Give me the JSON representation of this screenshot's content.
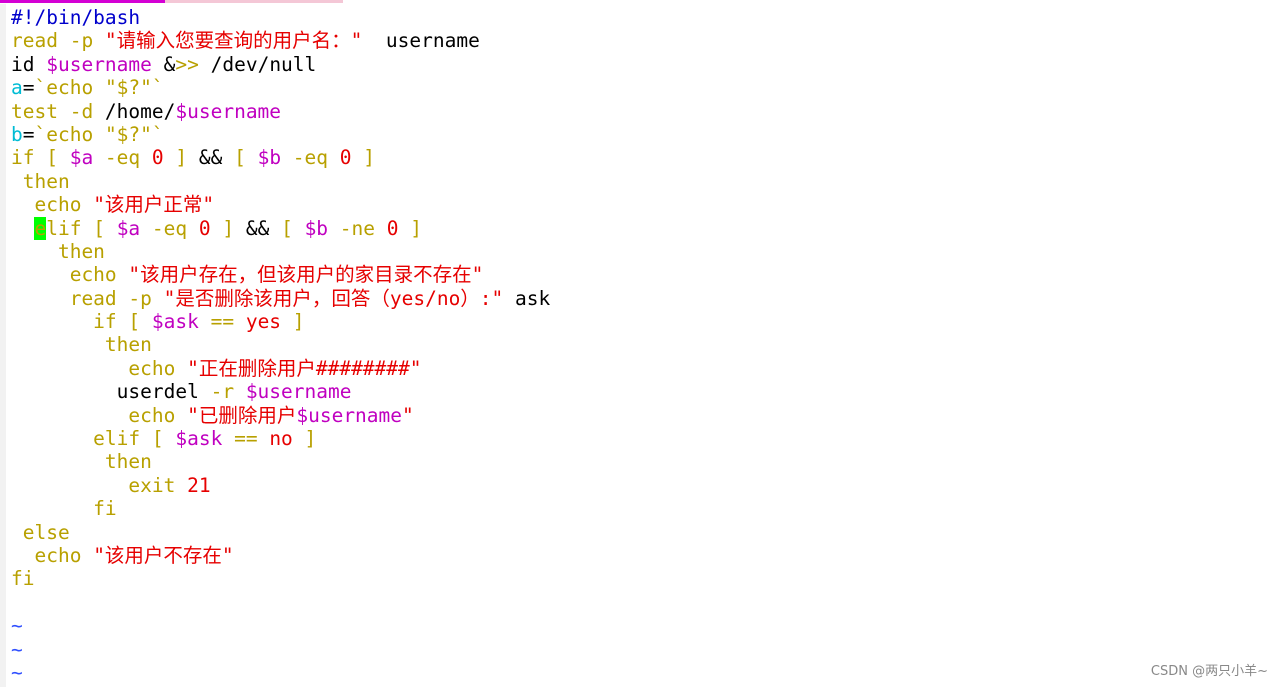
{
  "editor": {
    "colors": {
      "keyword": "#b8a000",
      "string": "#e60000",
      "variable": "#c000c0",
      "comment": "#0000cc",
      "assign": "#00bcd4",
      "plain": "#000000",
      "tilde": "#2f4fff",
      "cursor": "#00ff00"
    },
    "lines": [
      {
        "tokens": [
          {
            "t": "#!/bin/bash",
            "c": "comment"
          }
        ]
      },
      {
        "tokens": [
          {
            "t": "read -p ",
            "c": "keyword"
          },
          {
            "t": "\"请输入您要查询的用户名：\"",
            "c": "string"
          },
          {
            "t": "  username",
            "c": "plain"
          }
        ]
      },
      {
        "tokens": [
          {
            "t": "id ",
            "c": "plain"
          },
          {
            "t": "$username",
            "c": "variable"
          },
          {
            "t": " &",
            "c": "plain"
          },
          {
            "t": ">>",
            "c": "keyword"
          },
          {
            "t": " /dev/null",
            "c": "plain"
          }
        ]
      },
      {
        "tokens": [
          {
            "t": "a",
            "c": "assign"
          },
          {
            "t": "=",
            "c": "plain"
          },
          {
            "t": "`echo \"$?\"`",
            "c": "keyword"
          }
        ]
      },
      {
        "tokens": [
          {
            "t": "test -d ",
            "c": "keyword"
          },
          {
            "t": "/home/",
            "c": "plain"
          },
          {
            "t": "$username",
            "c": "variable"
          }
        ]
      },
      {
        "tokens": [
          {
            "t": "b",
            "c": "assign"
          },
          {
            "t": "=",
            "c": "plain"
          },
          {
            "t": "`echo \"$?\"`",
            "c": "keyword"
          }
        ]
      },
      {
        "tokens": [
          {
            "t": "if [ ",
            "c": "keyword"
          },
          {
            "t": "$a",
            "c": "variable"
          },
          {
            "t": " -eq ",
            "c": "keyword"
          },
          {
            "t": "0",
            "c": "string"
          },
          {
            "t": " ]",
            "c": "keyword"
          },
          {
            "t": " && ",
            "c": "plain"
          },
          {
            "t": "[ ",
            "c": "keyword"
          },
          {
            "t": "$b",
            "c": "variable"
          },
          {
            "t": " -eq ",
            "c": "keyword"
          },
          {
            "t": "0",
            "c": "string"
          },
          {
            "t": " ]",
            "c": "keyword"
          }
        ]
      },
      {
        "tokens": [
          {
            "t": " then",
            "c": "keyword"
          }
        ]
      },
      {
        "tokens": [
          {
            "t": "  echo ",
            "c": "keyword"
          },
          {
            "t": "\"该用户正常\"",
            "c": "string"
          }
        ]
      },
      {
        "tokens": [
          {
            "t": "  ",
            "c": "plain"
          },
          {
            "t": "e",
            "c": "cursor"
          },
          {
            "t": "lif [ ",
            "c": "keyword"
          },
          {
            "t": "$a",
            "c": "variable"
          },
          {
            "t": " -eq ",
            "c": "keyword"
          },
          {
            "t": "0",
            "c": "string"
          },
          {
            "t": " ]",
            "c": "keyword"
          },
          {
            "t": " && ",
            "c": "plain"
          },
          {
            "t": "[ ",
            "c": "keyword"
          },
          {
            "t": "$b",
            "c": "variable"
          },
          {
            "t": " -ne ",
            "c": "keyword"
          },
          {
            "t": "0",
            "c": "string"
          },
          {
            "t": " ]",
            "c": "keyword"
          }
        ]
      },
      {
        "tokens": [
          {
            "t": "    then",
            "c": "keyword"
          }
        ]
      },
      {
        "tokens": [
          {
            "t": "     echo ",
            "c": "keyword"
          },
          {
            "t": "\"该用户存在，但该用户的家目录不存在\"",
            "c": "string"
          }
        ]
      },
      {
        "tokens": [
          {
            "t": "     read -p ",
            "c": "keyword"
          },
          {
            "t": "\"是否删除该用户，回答（yes/no）:\"",
            "c": "string"
          },
          {
            "t": " ask",
            "c": "plain"
          }
        ]
      },
      {
        "tokens": [
          {
            "t": "       if [ ",
            "c": "keyword"
          },
          {
            "t": "$ask",
            "c": "variable"
          },
          {
            "t": " == ",
            "c": "keyword"
          },
          {
            "t": "yes",
            "c": "string"
          },
          {
            "t": " ]",
            "c": "keyword"
          }
        ]
      },
      {
        "tokens": [
          {
            "t": "        then",
            "c": "keyword"
          }
        ]
      },
      {
        "tokens": [
          {
            "t": "          echo ",
            "c": "keyword"
          },
          {
            "t": "\"正在删除用户########\"",
            "c": "string"
          }
        ]
      },
      {
        "tokens": [
          {
            "t": "         userdel",
            "c": "plain"
          },
          {
            "t": " -r ",
            "c": "keyword"
          },
          {
            "t": "$username",
            "c": "variable"
          }
        ]
      },
      {
        "tokens": [
          {
            "t": "          echo ",
            "c": "keyword"
          },
          {
            "t": "\"已删除用户",
            "c": "string"
          },
          {
            "t": "$username",
            "c": "variable"
          },
          {
            "t": "\"",
            "c": "string"
          }
        ]
      },
      {
        "tokens": [
          {
            "t": "       elif [ ",
            "c": "keyword"
          },
          {
            "t": "$ask",
            "c": "variable"
          },
          {
            "t": " == ",
            "c": "keyword"
          },
          {
            "t": "no",
            "c": "string"
          },
          {
            "t": " ]",
            "c": "keyword"
          }
        ]
      },
      {
        "tokens": [
          {
            "t": "        then",
            "c": "keyword"
          }
        ]
      },
      {
        "tokens": [
          {
            "t": "          exit ",
            "c": "keyword"
          },
          {
            "t": "21",
            "c": "string"
          }
        ]
      },
      {
        "tokens": [
          {
            "t": "       fi",
            "c": "keyword"
          }
        ]
      },
      {
        "tokens": [
          {
            "t": " else",
            "c": "keyword"
          }
        ]
      },
      {
        "tokens": [
          {
            "t": "  echo ",
            "c": "keyword"
          },
          {
            "t": "\"该用户不存在\"",
            "c": "string"
          }
        ]
      },
      {
        "tokens": [
          {
            "t": "fi",
            "c": "keyword"
          }
        ]
      },
      {
        "tokens": []
      },
      {
        "tokens": [
          {
            "t": "~",
            "c": "tilde"
          }
        ]
      },
      {
        "tokens": [
          {
            "t": "~",
            "c": "tilde"
          }
        ]
      },
      {
        "tokens": [
          {
            "t": "~",
            "c": "tilde"
          }
        ]
      }
    ]
  },
  "tabbar": {
    "active_color": "#d400d4",
    "inactive_color": "#f4c7d6"
  },
  "watermark": {
    "text": "CSDN @两只小羊~"
  }
}
